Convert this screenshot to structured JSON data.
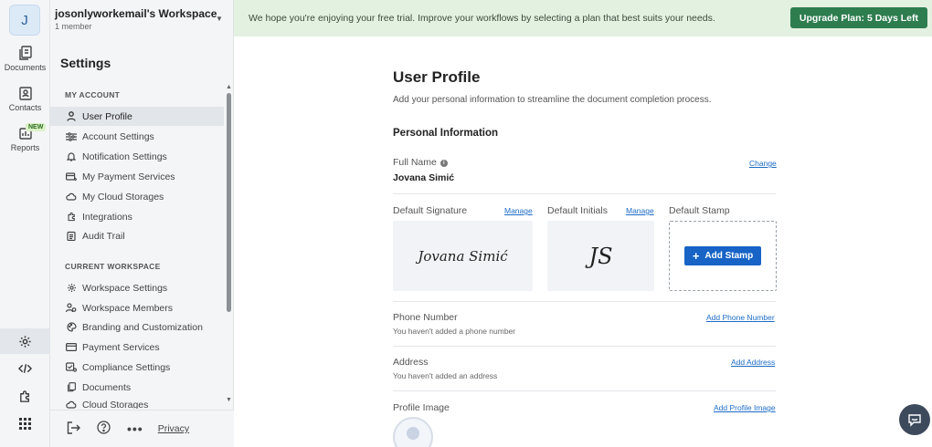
{
  "workspace": {
    "avatar_letter": "J",
    "name": "josonlyworkemail's Workspace",
    "members": "1 member"
  },
  "rail": {
    "documents_label": "Documents",
    "contacts_label": "Contacts",
    "reports_label": "Reports",
    "new_badge": "NEW"
  },
  "sidebar": {
    "title": "Settings",
    "my_account_label": "MY ACCOUNT",
    "my_account_items": [
      {
        "label": "User Profile",
        "icon": "user-icon"
      },
      {
        "label": "Account Settings",
        "icon": "sliders-icon"
      },
      {
        "label": "Notification Settings",
        "icon": "bell-icon"
      },
      {
        "label": "My Payment Services",
        "icon": "payment-icon"
      },
      {
        "label": "My Cloud Storages",
        "icon": "cloud-icon"
      },
      {
        "label": "Integrations",
        "icon": "puzzle-icon"
      },
      {
        "label": "Audit Trail",
        "icon": "clipboard-icon"
      }
    ],
    "current_workspace_label": "CURRENT WORKSPACE",
    "workspace_items": [
      {
        "label": "Workspace Settings",
        "icon": "gear-icon"
      },
      {
        "label": "Workspace Members",
        "icon": "members-icon"
      },
      {
        "label": "Branding and Customization",
        "icon": "palette-icon"
      },
      {
        "label": "Payment Services",
        "icon": "card-icon"
      },
      {
        "label": "Compliance Settings",
        "icon": "compliance-icon"
      },
      {
        "label": "Documents",
        "icon": "documents-icon"
      },
      {
        "label": "Cloud Storages",
        "icon": "cloud-icon"
      }
    ],
    "privacy_label": "Privacy"
  },
  "banner": {
    "message": "We hope you're enjoying your free trial. Improve your workflows by selecting a plan that best suits your needs.",
    "upgrade_label": "Upgrade Plan: 5 Days Left"
  },
  "profile": {
    "title": "User Profile",
    "lead": "Add your personal information to streamline the document completion process.",
    "section_title": "Personal Information",
    "full_name_label": "Full Name",
    "full_name_value": "Jovana Simić",
    "change_label": "Change",
    "default_signature_label": "Default Signature",
    "default_initials_label": "Default Initials",
    "default_stamp_label": "Default Stamp",
    "manage_label": "Manage",
    "signature_text": "Jovana Simić",
    "initials_text": "JS",
    "add_stamp_label": "Add Stamp",
    "phone_label": "Phone Number",
    "phone_hint": "You haven't added a phone number",
    "add_phone_label": "Add Phone Number",
    "address_label": "Address",
    "address_hint": "You haven't added an address",
    "add_address_label": "Add Address",
    "profile_image_label": "Profile Image",
    "add_profile_image_label": "Add Profile Image"
  },
  "colors": {
    "accent": "#1763c6",
    "upgrade": "#2e7d4f",
    "banner_bg": "#e3f1e1"
  }
}
